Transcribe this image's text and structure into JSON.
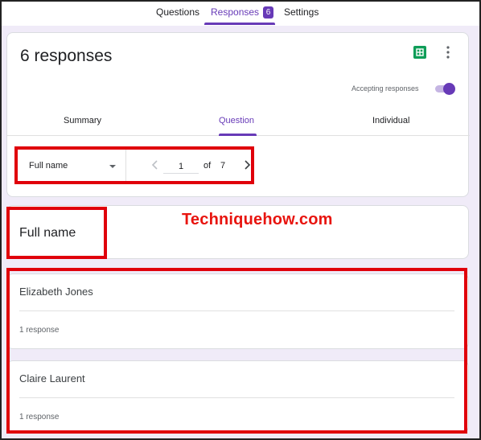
{
  "nav": {
    "tabs": [
      {
        "label": "Questions"
      },
      {
        "label": "Responses",
        "count": "6"
      },
      {
        "label": "Settings"
      }
    ]
  },
  "header": {
    "title": "6 responses",
    "accepting_label": "Accepting responses",
    "accepting_on": true
  },
  "subtabs": [
    {
      "label": "Summary"
    },
    {
      "label": "Question"
    },
    {
      "label": "Individual"
    }
  ],
  "selector": {
    "selected": "Full name",
    "page": "1",
    "of_label": "of",
    "total": "7"
  },
  "question": {
    "title": "Full name"
  },
  "watermark": "Techniquehow.com",
  "answers": [
    {
      "name": "Elizabeth Jones",
      "count": "1 response"
    },
    {
      "name": "Claire Laurent",
      "count": "1 response"
    }
  ],
  "colors": {
    "accent": "#673ab7",
    "highlight": "#e0000b",
    "watermark": "#e8140f"
  }
}
